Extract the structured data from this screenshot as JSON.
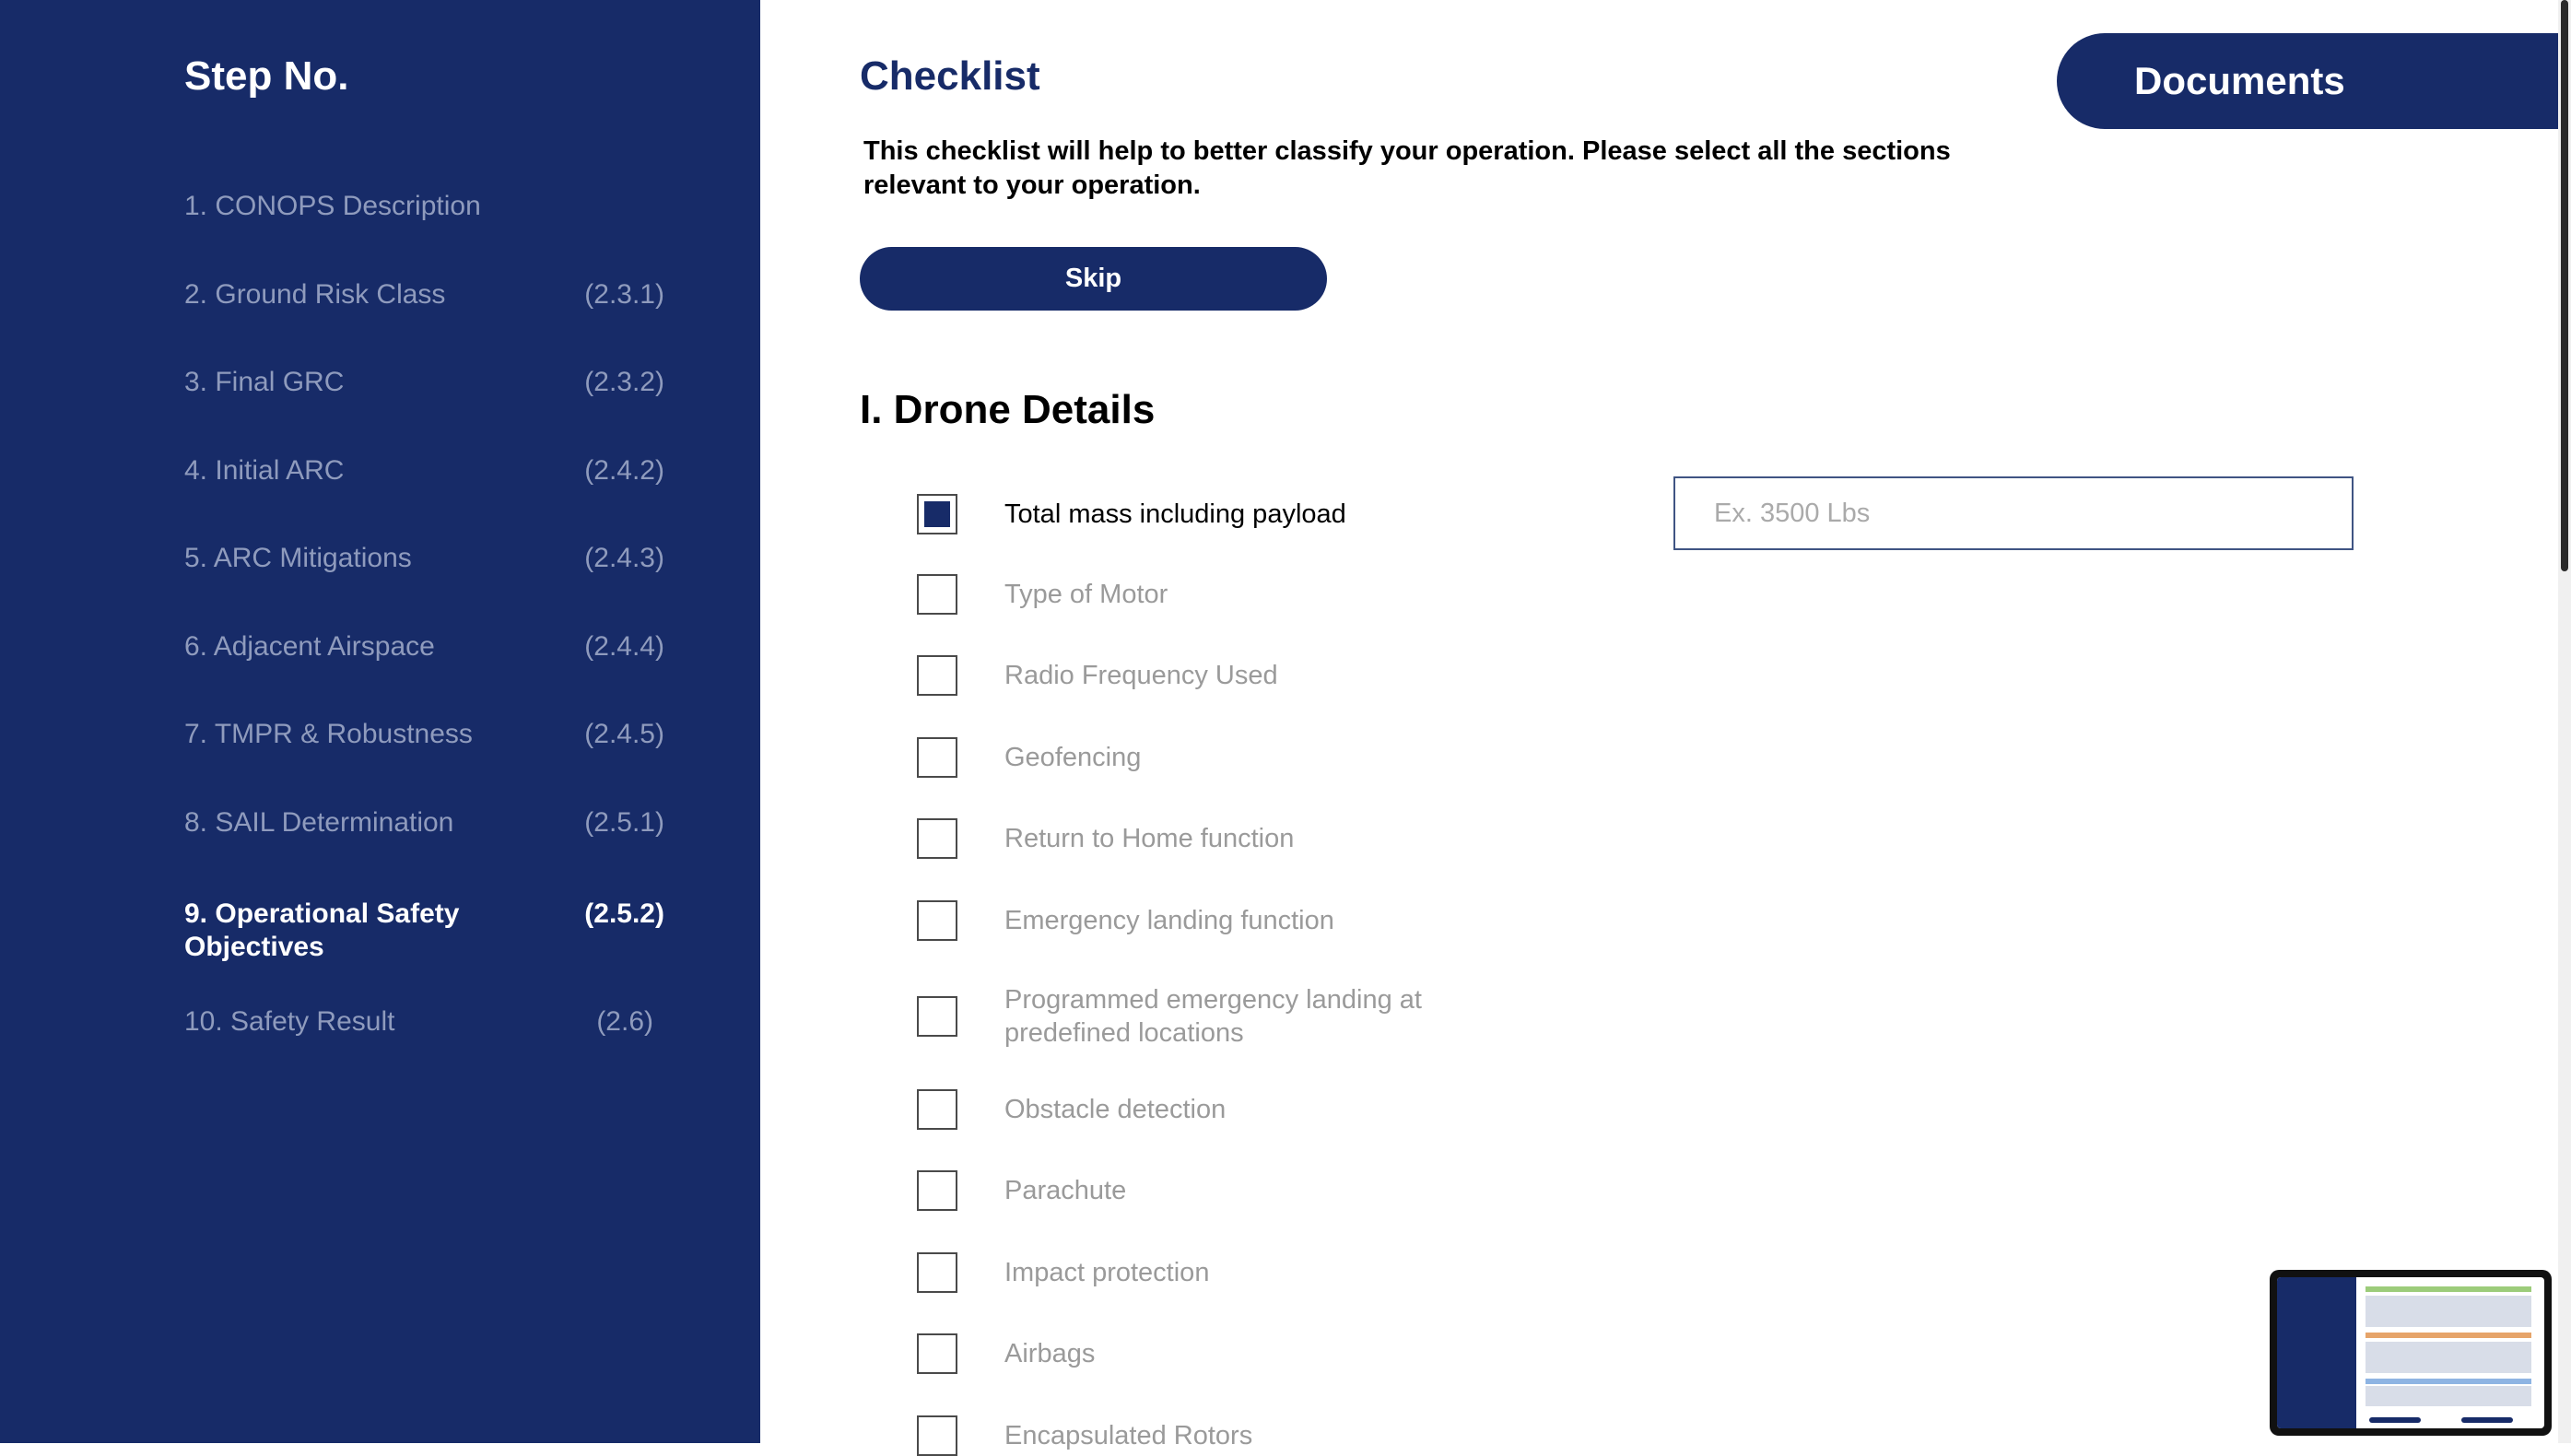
{
  "sidebar": {
    "title": "Step No.",
    "steps": [
      {
        "label": "1. CONOPS Description",
        "code": ""
      },
      {
        "label": "2. Ground Risk Class",
        "code": "(2.3.1)"
      },
      {
        "label": "3. Final GRC",
        "code": "(2.3.2)"
      },
      {
        "label": "4. Initial ARC",
        "code": "(2.4.2)"
      },
      {
        "label": "5. ARC Mitigations",
        "code": "(2.4.3)"
      },
      {
        "label": "6. Adjacent Airspace",
        "code": "(2.4.4)"
      },
      {
        "label": "7. TMPR & Robustness",
        "code": "(2.4.5)"
      },
      {
        "label": "8. SAIL Determination",
        "code": "(2.5.1)"
      },
      {
        "label": "9. Operational Safety Objectives",
        "code": "(2.5.2)",
        "active": true
      },
      {
        "label": "10. Safety Result",
        "code": "(2.6)"
      }
    ]
  },
  "header": {
    "title": "Checklist",
    "documents_label": "Documents"
  },
  "intro": "This checklist will help to better classify your operation. Please select all the sections relevant to your operation.",
  "skip_label": "Skip",
  "section": {
    "title": "I. Drone Details",
    "items": [
      {
        "label": "Total mass including payload",
        "checked": true
      },
      {
        "label": "Type of Motor",
        "checked": false
      },
      {
        "label": "Radio Frequency Used",
        "checked": false
      },
      {
        "label": "Geofencing",
        "checked": false
      },
      {
        "label": "Return to Home function",
        "checked": false
      },
      {
        "label": "Emergency landing function",
        "checked": false
      },
      {
        "label": "Programmed emergency landing at predefined locations",
        "checked": false
      },
      {
        "label": "Obstacle detection",
        "checked": false
      },
      {
        "label": "Parachute",
        "checked": false
      },
      {
        "label": "Impact protection",
        "checked": false
      },
      {
        "label": "Airbags",
        "checked": false
      },
      {
        "label": "Encapsulated Rotors",
        "checked": false
      }
    ],
    "mass_input": {
      "placeholder": "Ex. 3500 Lbs",
      "value": ""
    }
  },
  "colors": {
    "brand": "#172b68",
    "muted_text": "#9a9a9a"
  }
}
